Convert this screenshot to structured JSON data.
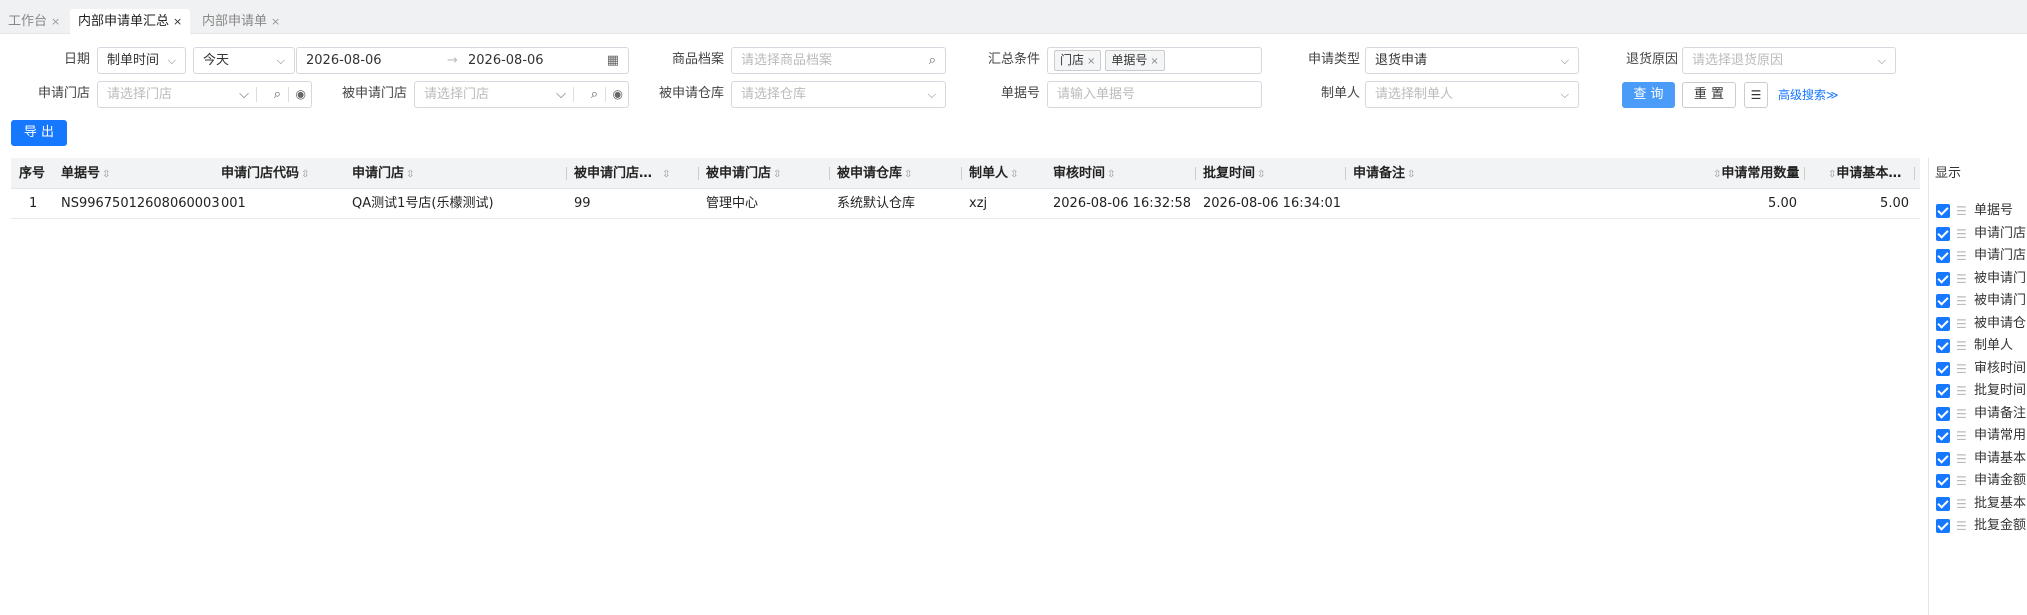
{
  "tabs": [
    {
      "label": "工作台"
    },
    {
      "label": "内部申请单汇总"
    },
    {
      "label": "内部申请单"
    }
  ],
  "tab_close": "×",
  "filters": {
    "date_label": "日期",
    "date_type": "制单时间",
    "date_range": "今天",
    "date_from": "2026-08-06",
    "date_arrow": "→",
    "date_to": "2026-08-06",
    "goods_label": "商品档案",
    "goods_placeholder": "请选择商品档案",
    "summary_label": "汇总条件",
    "summary_tags": [
      "门店",
      "单据号"
    ],
    "apply_type_label": "申请类型",
    "apply_type_value": "退货申请",
    "return_reason_label": "退货原因",
    "return_reason_placeholder": "请选择退货原因",
    "apply_store_label": "申请门店",
    "apply_store_placeholder": "请选择门店",
    "target_store_label": "被申请门店",
    "target_store_placeholder": "请选择门店",
    "target_wh_label": "被申请仓库",
    "target_wh_placeholder": "请选择仓库",
    "doc_no_label": "单据号",
    "doc_no_placeholder": "请输入单据号",
    "creator_label": "制单人",
    "creator_placeholder": "请选择制单人",
    "query_button": "查 询",
    "reset_button": "重 置",
    "advanced_search": "高级搜索≫"
  },
  "export_button": "导 出",
  "table": {
    "columns": [
      "序号",
      "单据号",
      "申请门店代码",
      "申请门店",
      "被申请门店…",
      "被申请门店",
      "被申请仓库",
      "制单人",
      "审核时间",
      "批复时间",
      "申请备注",
      "申请常用数量",
      "申请基本…"
    ],
    "rows": [
      [
        "1",
        "NS99675012608060003",
        "001",
        "QA测试1号店(乐檬测试)",
        "99",
        "管理中心",
        "系统默认仓库",
        "xzj",
        "2026-08-06 16:32:58",
        "2026-08-06 16:34:01",
        "",
        "5.00",
        "5.00"
      ]
    ]
  },
  "column_panel": {
    "title": "显示",
    "items": [
      "单据号",
      "申请门店",
      "申请门店",
      "被申请门",
      "被申请门",
      "被申请仓",
      "制单人",
      "审核时间",
      "批复时间",
      "申请备注",
      "申请常用",
      "申请基本",
      "申请金额",
      "批复基本",
      "批复金额"
    ]
  },
  "colors": {
    "accent": "#1677ff",
    "query": "#4b9cf8"
  }
}
